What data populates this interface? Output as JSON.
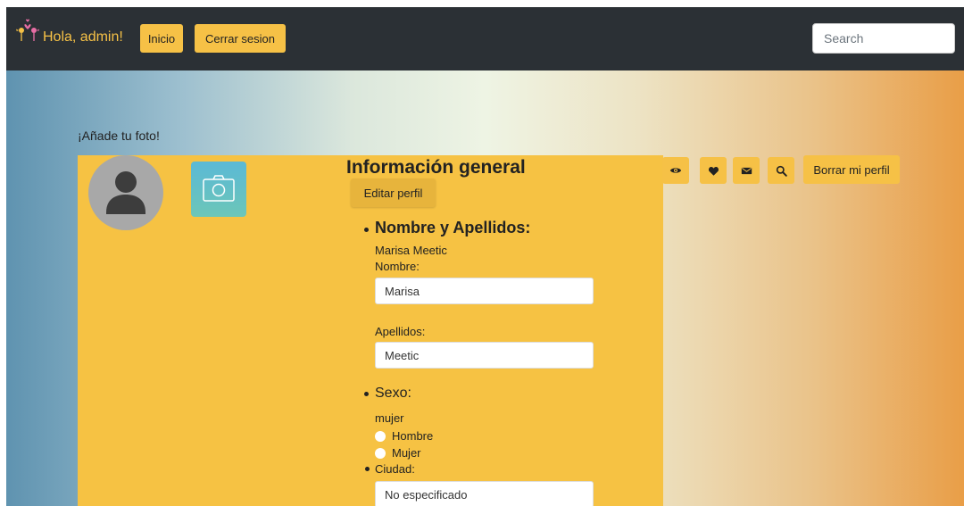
{
  "header": {
    "brand_text": "Hola, admin!",
    "nav": [
      {
        "label": "Inicio"
      },
      {
        "label": "Cerrar sesion"
      }
    ],
    "search_placeholder": "Search"
  },
  "profile": {
    "add_photo_label": "¡Añade tu foto!",
    "section_title": "Información general",
    "edit_button": "Editar perfil",
    "name_section": {
      "heading": "Nombre y Apellidos:",
      "full_name": "Marisa Meetic",
      "first_name_label": "Nombre:",
      "first_name_value": "Marisa",
      "last_name_label": "Apellidos:",
      "last_name_value": "Meetic"
    },
    "sex_section": {
      "heading": "Sexo:",
      "current_value": "mujer",
      "options": [
        "Hombre",
        "Mujer"
      ]
    },
    "city_section": {
      "heading": "Ciudad:",
      "value": "No especificado"
    }
  },
  "actions": {
    "icons": [
      "eye-icon",
      "heart-icon",
      "envelope-icon",
      "search-icon"
    ],
    "delete_label": "Borrar mi perfil"
  },
  "colors": {
    "accent": "#f6c146",
    "topbar": "#2b3035",
    "card": "#f6c243"
  }
}
